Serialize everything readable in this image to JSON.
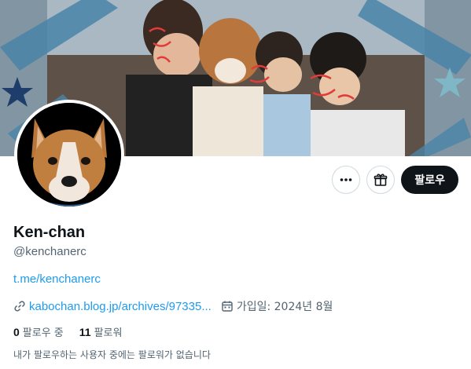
{
  "profile": {
    "name": "Ken-chan",
    "handle": "@kenchanerc",
    "bio_link": "t.me/kenchanerc",
    "website": "kabochan.blog.jp/archives/97335...",
    "joined": "가입일: 2024년 8월"
  },
  "actions": {
    "more_icon": "more-icon",
    "gift_icon": "gift-icon",
    "follow_label": "팔로우"
  },
  "stats": {
    "following_count": "0",
    "following_label": "팔로우 중",
    "followers_count": "11",
    "followers_label": "팔로워"
  },
  "followers_note": "내가 팔로우하는 사용자 중에는 팔로워가 없습니다",
  "colors": {
    "accent": "#1d9bf0",
    "primary_text": "#0f1419",
    "secondary_text": "#536471",
    "button_dark": "#0f1419",
    "border": "#cfd9de"
  }
}
